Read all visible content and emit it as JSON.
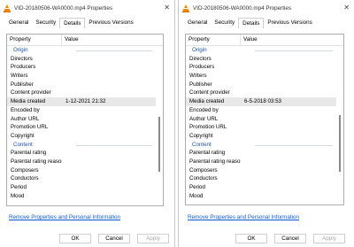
{
  "dialogs": [
    {
      "title": "VID-20180506-WA0000.mp4 Properties",
      "close_glyph": "✕",
      "tabs": [
        "General",
        "Security",
        "Details",
        "Previous Versions"
      ],
      "active_tab": "Details",
      "columns": [
        "Property",
        "Value"
      ],
      "rows": [
        {
          "type": "group",
          "label": "Origin"
        },
        {
          "label": "Directors",
          "value": ""
        },
        {
          "label": "Producers",
          "value": ""
        },
        {
          "label": "Writers",
          "value": ""
        },
        {
          "label": "Publisher",
          "value": ""
        },
        {
          "label": "Content provider",
          "value": ""
        },
        {
          "label": "Media created",
          "value": "1-12-2021 21:32",
          "selected": true
        },
        {
          "label": "Encoded by",
          "value": ""
        },
        {
          "label": "Author URL",
          "value": ""
        },
        {
          "label": "Promotion URL",
          "value": ""
        },
        {
          "label": "Copyright",
          "value": ""
        },
        {
          "type": "group",
          "label": "Content"
        },
        {
          "label": "Parental rating",
          "value": ""
        },
        {
          "label": "Parental rating reason",
          "value": ""
        },
        {
          "label": "Composers",
          "value": ""
        },
        {
          "label": "Conductors",
          "value": ""
        },
        {
          "label": "Period",
          "value": ""
        },
        {
          "label": "Mood",
          "value": ""
        }
      ],
      "remove_link": "Remove Properties and Personal Information",
      "buttons": {
        "ok": "OK",
        "cancel": "Cancel",
        "apply": "Apply"
      }
    },
    {
      "title": "VID-20180506-WA0000.mp4 Properties",
      "close_glyph": "✕",
      "tabs": [
        "General",
        "Security",
        "Details",
        "Previous Versions"
      ],
      "active_tab": "Details",
      "columns": [
        "Property",
        "Value"
      ],
      "rows": [
        {
          "type": "group",
          "label": "Origin"
        },
        {
          "label": "Directors",
          "value": ""
        },
        {
          "label": "Producers",
          "value": ""
        },
        {
          "label": "Writers",
          "value": ""
        },
        {
          "label": "Publisher",
          "value": ""
        },
        {
          "label": "Content provider",
          "value": ""
        },
        {
          "label": "Media created",
          "value": "6-5-2018 03:53",
          "selected": true
        },
        {
          "label": "Encoded by",
          "value": ""
        },
        {
          "label": "Author URL",
          "value": ""
        },
        {
          "label": "Promotion URL",
          "value": ""
        },
        {
          "label": "Copyright",
          "value": ""
        },
        {
          "type": "group",
          "label": "Content"
        },
        {
          "label": "Parental rating",
          "value": ""
        },
        {
          "label": "Parental rating reason",
          "value": ""
        },
        {
          "label": "Composers",
          "value": ""
        },
        {
          "label": "Conductors",
          "value": ""
        },
        {
          "label": "Period",
          "value": ""
        },
        {
          "label": "Mood",
          "value": ""
        }
      ],
      "remove_link": "Remove Properties and Personal Information",
      "buttons": {
        "ok": "OK",
        "cancel": "Cancel",
        "apply": "Apply"
      }
    }
  ],
  "colors": {
    "link": "#0b5bd0",
    "group_header": "#1a52a8",
    "vlc_orange": "#f28a00",
    "selected_row": "#e8e8e8"
  },
  "icons": {
    "window_icon": "vlc-cone-icon",
    "close": "close-icon"
  }
}
